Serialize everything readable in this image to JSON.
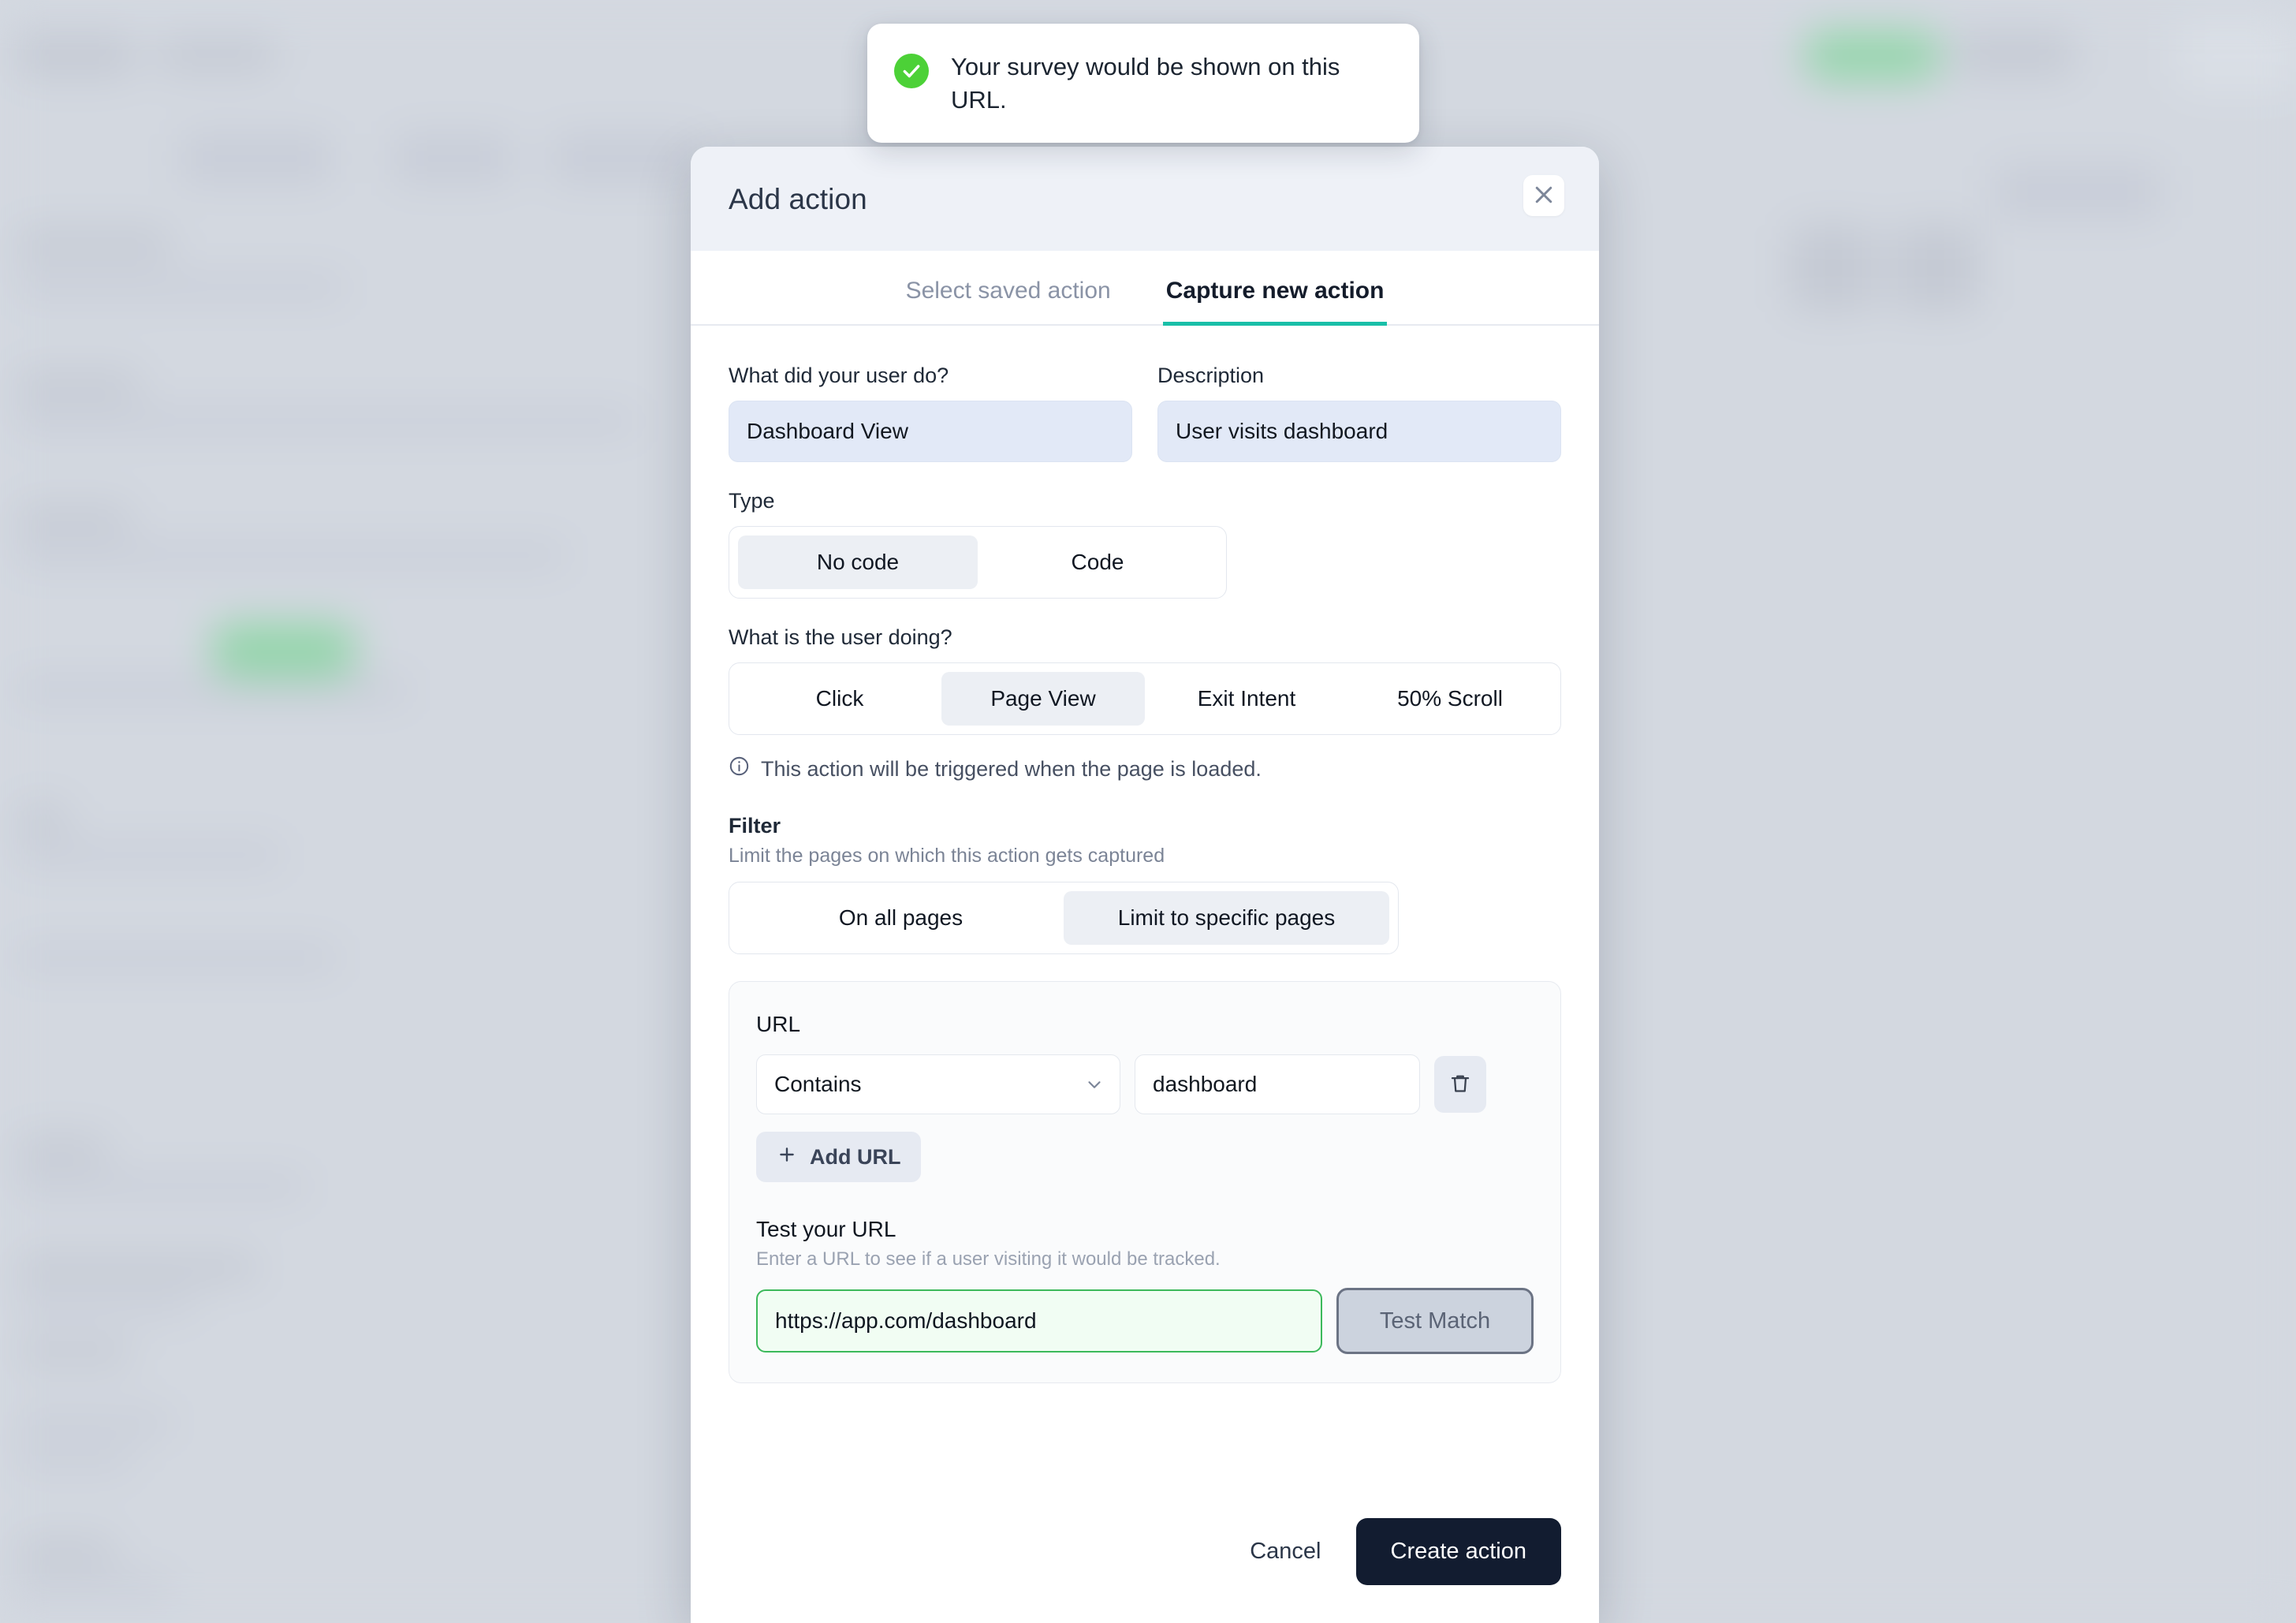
{
  "toast": {
    "icon": "check-circle-icon",
    "message": "Your survey would be shown on this URL.",
    "icon_color": "#4cd137"
  },
  "modal": {
    "title": "Add action",
    "close_icon": "close-icon",
    "tabs": [
      {
        "label": "Select saved action",
        "active": false
      },
      {
        "label": "Capture new action",
        "active": true
      }
    ],
    "accent_color": "#19bfa8",
    "fields": {
      "name": {
        "label": "What did your user do?",
        "value": "Dashboard View",
        "placeholder": "What did your user do?"
      },
      "description": {
        "label": "Description",
        "value": "User visits dashboard",
        "placeholder": "Description"
      }
    },
    "type": {
      "label": "Type",
      "options": [
        "No code",
        "Code"
      ],
      "selected": "No code"
    },
    "doing": {
      "label": "What is the user doing?",
      "options": [
        "Click",
        "Page View",
        "Exit Intent",
        "50% Scroll"
      ],
      "selected": "Page View"
    },
    "hint": {
      "icon": "info-icon",
      "text": "This action will be triggered when the page is loaded."
    },
    "filter": {
      "label": "Filter",
      "sublabel": "Limit the pages on which this action gets captured",
      "options": [
        "On all pages",
        "Limit to specific pages"
      ],
      "selected": "Limit to specific pages"
    },
    "url_card": {
      "title": "URL",
      "match_type": {
        "value": "Contains",
        "chevron_icon": "chevron-down-icon"
      },
      "url_value": "dashboard",
      "delete_icon": "trash-icon",
      "add_url": {
        "label": "Add URL",
        "icon": "plus-icon"
      },
      "test": {
        "title": "Test your URL",
        "sublabel": "Enter a URL to see if a user visiting it would be tracked.",
        "value": "https://app.com/dashboard",
        "placeholder": "https://app.com/dashboard",
        "button_label": "Test Match",
        "success_color": "#3cb95b"
      }
    },
    "footer": {
      "cancel_label": "Cancel",
      "create_label": "Create action",
      "create_color": "#121c30"
    }
  }
}
